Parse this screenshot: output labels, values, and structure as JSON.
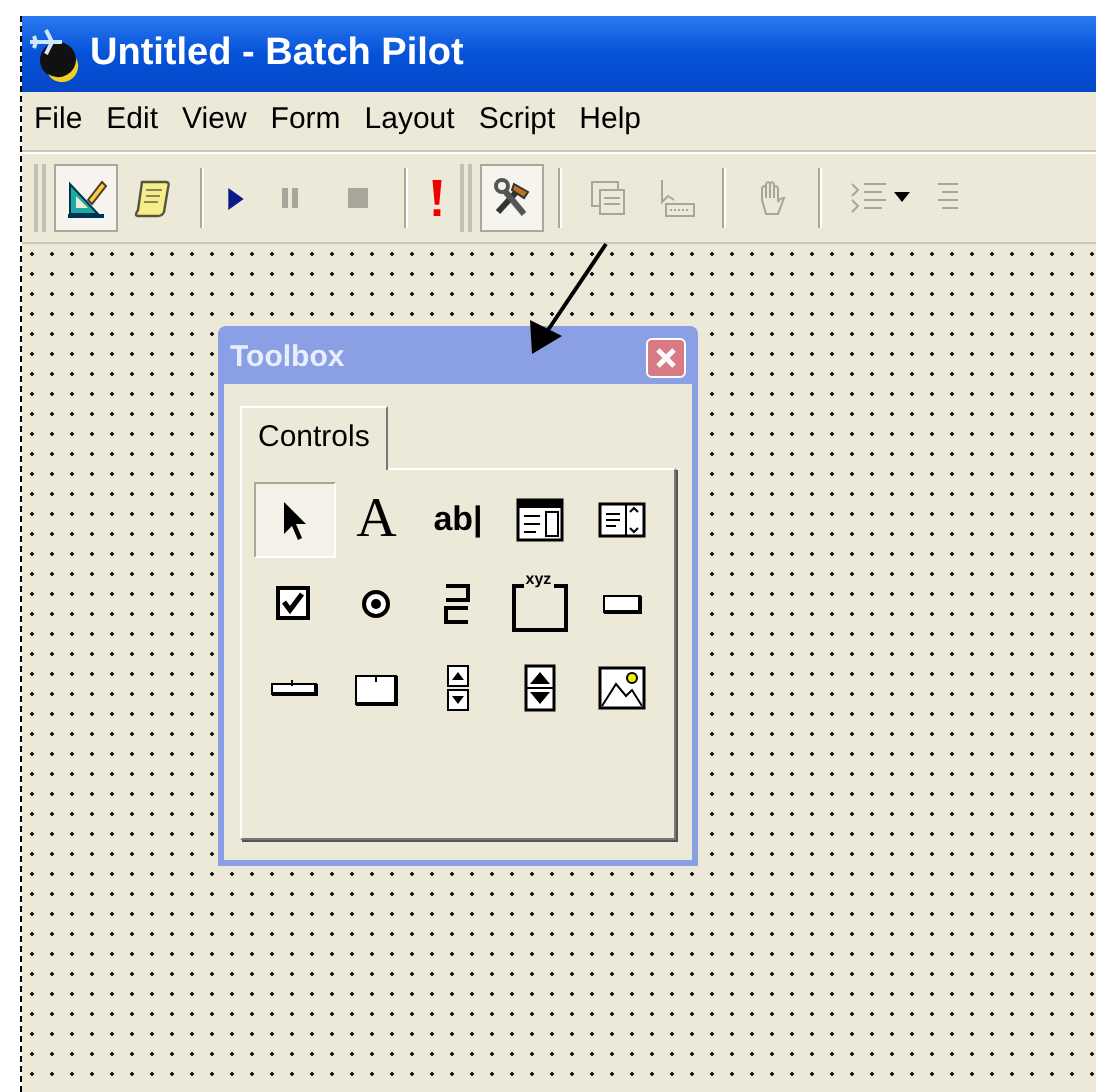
{
  "window": {
    "title": "Untitled - Batch Pilot"
  },
  "menu": [
    "File",
    "Edit",
    "View",
    "Form",
    "Layout",
    "Script",
    "Help"
  ],
  "toolbar": [
    {
      "kind": "grip"
    },
    {
      "kind": "design",
      "pressed": true,
      "disabled": false
    },
    {
      "kind": "script",
      "pressed": false,
      "disabled": false
    },
    {
      "kind": "separator"
    },
    {
      "kind": "run",
      "pressed": false,
      "disabled": false
    },
    {
      "kind": "pause",
      "pressed": false,
      "disabled": true
    },
    {
      "kind": "stop",
      "pressed": false,
      "disabled": true
    },
    {
      "kind": "separator"
    },
    {
      "kind": "alert",
      "pressed": false,
      "disabled": false
    },
    {
      "kind": "grip"
    },
    {
      "kind": "tools",
      "pressed": true,
      "disabled": false
    },
    {
      "kind": "separator"
    },
    {
      "kind": "form",
      "pressed": false,
      "disabled": true
    },
    {
      "kind": "taborder",
      "pressed": false,
      "disabled": true
    },
    {
      "kind": "separator"
    },
    {
      "kind": "hand",
      "pressed": false,
      "disabled": true
    },
    {
      "kind": "separator"
    },
    {
      "kind": "indent",
      "pressed": false,
      "disabled": true
    },
    {
      "kind": "lines",
      "pressed": false,
      "disabled": true
    }
  ],
  "toolbox": {
    "title": "Toolbox",
    "tabs": [
      {
        "label": "Controls",
        "selected": true
      }
    ],
    "tools": [
      {
        "kind": "pointer",
        "selected": true
      },
      {
        "kind": "label",
        "glyph": "A",
        "selected": false
      },
      {
        "kind": "textbox",
        "glyph": "ab|",
        "selected": false
      },
      {
        "kind": "combobox",
        "selected": false
      },
      {
        "kind": "listbox",
        "selected": false
      },
      {
        "kind": "checkbox",
        "selected": false
      },
      {
        "kind": "radio",
        "selected": false
      },
      {
        "kind": "toggle",
        "selected": false
      },
      {
        "kind": "frame",
        "glyph": "xyz",
        "selected": false
      },
      {
        "kind": "button",
        "selected": false
      },
      {
        "kind": "tabstrip",
        "selected": false
      },
      {
        "kind": "multipage",
        "selected": false
      },
      {
        "kind": "spinner",
        "selected": false
      },
      {
        "kind": "scrollbar",
        "selected": false
      },
      {
        "kind": "image",
        "selected": false
      }
    ]
  }
}
